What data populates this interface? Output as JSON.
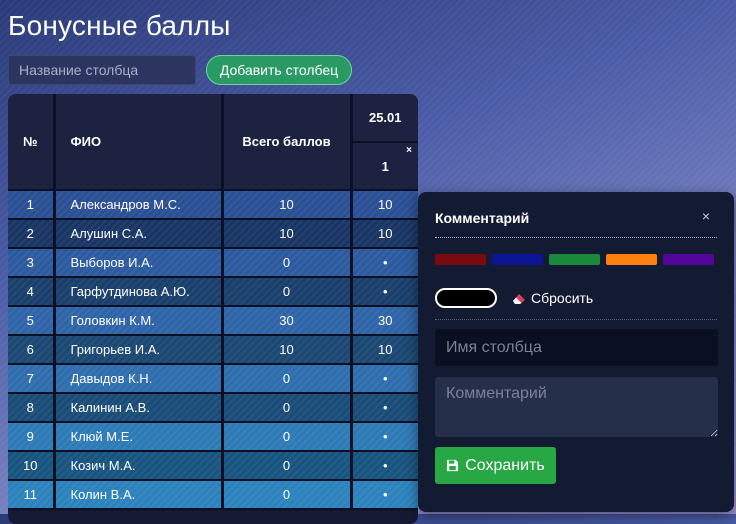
{
  "page": {
    "title": "Бонусные баллы"
  },
  "toolbar": {
    "column_name_placeholder": "Название столбца",
    "add_column_label": "Добавить столбец"
  },
  "table": {
    "headers": {
      "num": "№",
      "name": "ФИО",
      "total": "Всего баллов",
      "date": "25.01",
      "date_sub": "1",
      "remove_mark": "×"
    },
    "rows": [
      {
        "num": "1",
        "name": "Александров  М.С.",
        "total": "10",
        "score": "10",
        "bg": "#2a4f94"
      },
      {
        "num": "2",
        "name": "Алушин  С.А.",
        "total": "10",
        "score": "10",
        "bg": "#193565"
      },
      {
        "num": "3",
        "name": "Выборов  И.А.",
        "total": "0",
        "score": "•",
        "bg": "#2c5a9f"
      },
      {
        "num": "4",
        "name": "Гарфутдинова  А.Ю.",
        "total": "0",
        "score": "•",
        "bg": "#1a3f6c"
      },
      {
        "num": "5",
        "name": "Головкин  К.М.",
        "total": "30",
        "score": "30",
        "bg": "#2e64a8"
      },
      {
        "num": "6",
        "name": "Григорьев  И.А.",
        "total": "10",
        "score": "10",
        "bg": "#1b4773"
      },
      {
        "num": "7",
        "name": "Давыдов  К.Н.",
        "total": "0",
        "score": "•",
        "bg": "#2f6eae"
      },
      {
        "num": "8",
        "name": "Калинин  А.В.",
        "total": "0",
        "score": "•",
        "bg": "#1a4c78"
      },
      {
        "num": "9",
        "name": "Клюй  М.Е.",
        "total": "0",
        "score": "•",
        "bg": "#2d7ab6"
      },
      {
        "num": "10",
        "name": "Козич  М.А.",
        "total": "0",
        "score": "•",
        "bg": "#185480"
      },
      {
        "num": "11",
        "name": "Колин  В.А.",
        "total": "0",
        "score": "•",
        "bg": "#2c82bd"
      }
    ]
  },
  "modal": {
    "title": "Комментарий",
    "close": "×",
    "swatches": [
      "#7a0a12",
      "#0c1694",
      "#1a8a3a",
      "#ff7f0f",
      "#52079a"
    ],
    "color_value": "#000000",
    "reset_label": "Сбросить",
    "column_name_placeholder": "Имя столбца",
    "comment_placeholder": "Комментарий",
    "save_label": "Сохранить"
  }
}
